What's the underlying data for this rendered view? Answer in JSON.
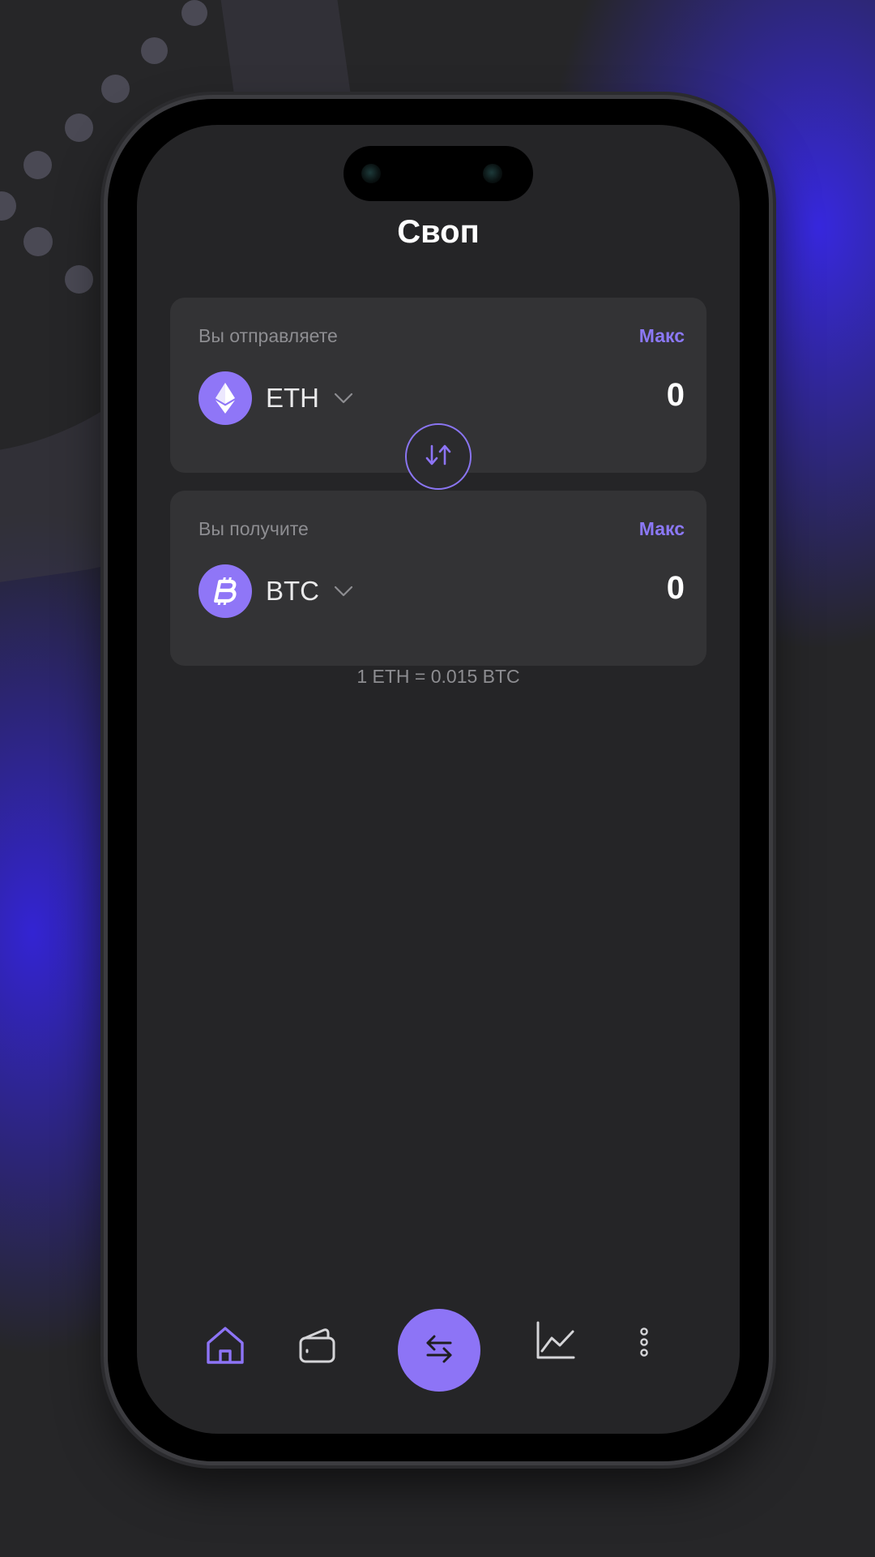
{
  "header": {
    "title": "Своп"
  },
  "send": {
    "label": "Вы отправляете",
    "max_label": "Макс",
    "coin": "ETH",
    "coin_icon": "ethereum-icon",
    "amount": "0"
  },
  "receive": {
    "label": "Вы получите",
    "max_label": "Макс",
    "coin": "BTC",
    "coin_icon": "bitcoin-icon",
    "amount": "0"
  },
  "rate": "1 ETH = 0.015 BTC",
  "bottom_nav": {
    "items": [
      {
        "icon": "home-icon",
        "active": true
      },
      {
        "icon": "wallet-icon",
        "active": false
      },
      {
        "icon": "swap-icon",
        "active": true
      },
      {
        "icon": "chart-icon",
        "active": false
      },
      {
        "icon": "more-vertical-icon",
        "active": false
      }
    ]
  },
  "colors": {
    "accent": "#8d74f6",
    "card_background": "#333335",
    "screen_background": "#252527",
    "muted_text": "#8d8d91"
  }
}
